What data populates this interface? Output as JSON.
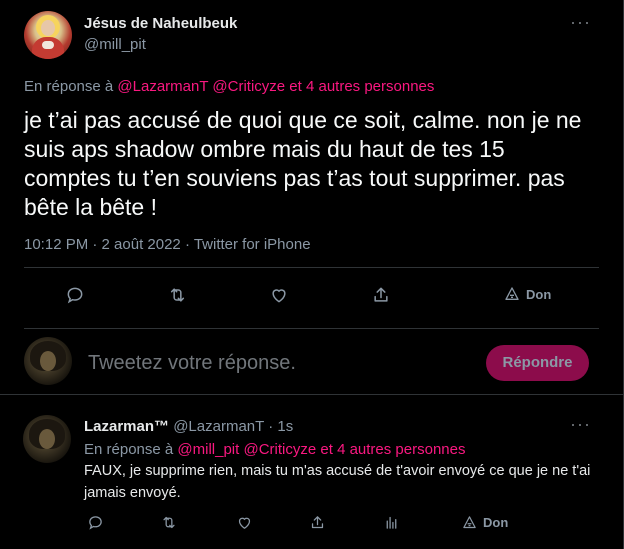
{
  "main_tweet": {
    "author_name": "Jésus de Naheulbeuk",
    "author_handle": "@mill_pit",
    "more_glyph": "···",
    "replying_prefix": "En réponse à",
    "replying_mentions": "@LazarmanT @Criticyze",
    "replying_suffix": "et 4 autres personnes",
    "text": "je t’ai pas accusé de quoi que ce soit, calme. non je ne suis aps shadow ombre mais du haut de tes 15 comptes tu t’en souviens pas t’as tout supprimer. pas bête la bête !",
    "meta": "10:12 PM · 2 août 2022 · Twitter for iPhone",
    "actions": {
      "reply_icon": "reply-icon",
      "retweet_icon": "retweet-icon",
      "like_icon": "heart-icon",
      "share_icon": "share-icon",
      "donate_icon": "tip-icon",
      "donate_label": "Don"
    }
  },
  "composer": {
    "placeholder": "Tweetez votre réponse.",
    "reply_button": "Répondre"
  },
  "reply_tweet": {
    "author_name": "Lazarman™",
    "author_handle": "@LazarmanT",
    "time": "· 1s",
    "more_glyph": "···",
    "replying_prefix": "En réponse à",
    "replying_mentions": "@mill_pit @Criticyze",
    "replying_suffix": "et 4 autres personnes",
    "text": "FAUX, je supprime rien, mais tu m'as accusé de t'avoir envoyé ce que je ne t'ai jamais envoyé.",
    "actions": {
      "donate_label": "Don"
    }
  },
  "colors": {
    "background": "#000000",
    "mention": "#f91880",
    "secondary_text": "#8b98a5",
    "reply_button_bg": "#8c0c4b",
    "divider": "#2f3336"
  }
}
